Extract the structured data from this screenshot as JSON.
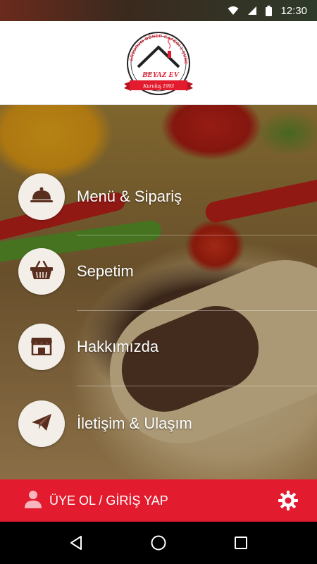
{
  "status_bar": {
    "time": "12:30",
    "icons": [
      "wifi-icon",
      "signal-icon",
      "battery-icon"
    ]
  },
  "header": {
    "logo": {
      "arc_text": "ERZURUM DÖNER KAFESİ 1 ŞUBE",
      "small_text": "döner",
      "brand_name": "BEYAZ EV",
      "ribbon_text": "Kuruluş 1993"
    }
  },
  "menu": {
    "items": [
      {
        "label": "Menü & Sipariş",
        "icon": "cloche-icon"
      },
      {
        "label": "Sepetim",
        "icon": "basket-icon"
      },
      {
        "label": "Hakkımızda",
        "icon": "storefront-icon"
      },
      {
        "label": "İletişim & Ulaşım",
        "icon": "paper-plane-icon"
      }
    ]
  },
  "account_bar": {
    "label": "ÜYE OL / GİRİŞ YAP",
    "icon": "user-icon",
    "settings_icon": "gear-icon"
  },
  "nav_bar": {
    "buttons": [
      "back-icon",
      "home-icon",
      "recents-icon"
    ]
  },
  "colors": {
    "accent_red": "#e31b2e",
    "icon_brown": "#5a2e1e",
    "circle_bg": "#f3efe8"
  }
}
